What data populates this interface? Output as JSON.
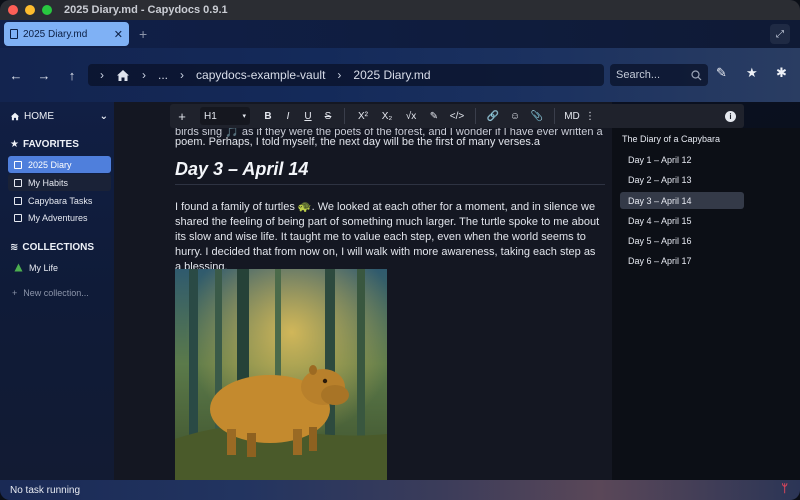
{
  "window": {
    "title": "2025 Diary.md - Capydocs 0.9.1"
  },
  "tabs": [
    {
      "label": "2025 Diary.md",
      "close": "✕"
    }
  ],
  "tabbar": {
    "new_tab": "+",
    "expand_icon": "⤢"
  },
  "nav": {
    "back": "←",
    "forward": "→",
    "up": "↑",
    "breadcrumb": [
      "...",
      "capydocs-example-vault",
      "2025 Diary.md"
    ],
    "search_placeholder": "Search..."
  },
  "sidebar": {
    "home": "HOME",
    "favorites_header": "FAVORITES",
    "favorites": [
      "2025 Diary",
      "My Habits",
      "Capybara Tasks",
      "My Adventures"
    ],
    "collections_header": "COLLECTIONS",
    "collections": [
      "My Life"
    ],
    "new_collection": "New collection..."
  },
  "toolbar": {
    "add": "+",
    "heading_select": "H1",
    "bold": "B",
    "italic": "I",
    "underline": "U",
    "strike": "S",
    "superscript": "X²",
    "subscript": "X₂",
    "formula": "√x",
    "highlight": "✎",
    "code": "</>",
    "link": "🔗",
    "emoji": "☺",
    "attach": "📎",
    "markdown": "MD",
    "more": "⋮",
    "info": "i"
  },
  "editor": {
    "partial_line": "birds sing 🎵 as if they were the poets of the forest, and I wonder if I have ever written a",
    "paragraph1": "poem. Perhaps, I told myself, the next day will be the first of many verses.a",
    "heading": "Day 3 – April 14",
    "paragraph2": "I found a family of turtles 🐢. We looked at each other for a moment, and in silence we shared the feeling of being part of something much larger. The turtle spoke to me about its slow and wise life. It taught me to value each step, even when the world seems to hurry. I decided that from now on, I will walk with more awareness, taking each step as a blessing."
  },
  "outline": {
    "title": "The Diary of a Capybara",
    "items": [
      "Day 1 – April 12",
      "Day 2 – April 13",
      "Day 3 – April 14",
      "Day 4 – April 15",
      "Day 5 – April 16",
      "Day 6 – April 17"
    ],
    "active_index": 2
  },
  "status": {
    "text": "No task running",
    "branch_icon": "ᛘ"
  },
  "colors": {
    "accent": "#4f7fdc",
    "tab_active": "#7fb1f5",
    "status_icon": "#e0455b"
  }
}
